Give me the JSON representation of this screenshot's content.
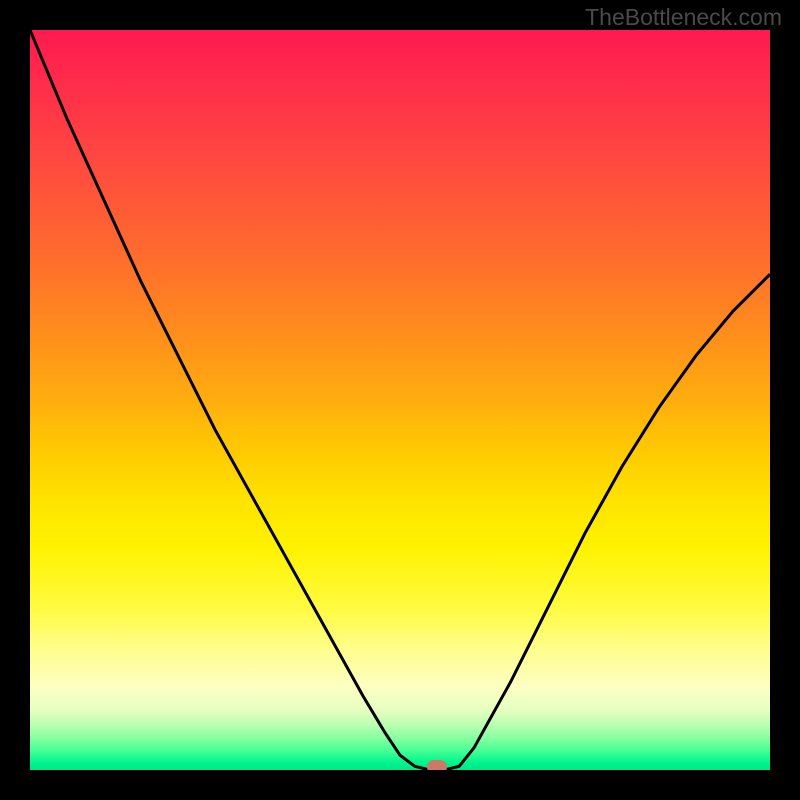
{
  "watermark": "TheBottleneck.com",
  "chart_data": {
    "type": "line",
    "title": "",
    "xlabel": "",
    "ylabel": "",
    "x_range": [
      0,
      100
    ],
    "y_range": [
      0,
      100
    ],
    "series": [
      {
        "name": "curve",
        "x": [
          0,
          5,
          10,
          15,
          20,
          25,
          30,
          35,
          40,
          45,
          48,
          50,
          52,
          54,
          56,
          58,
          60,
          65,
          70,
          75,
          80,
          85,
          90,
          95,
          100
        ],
        "y": [
          100,
          88,
          77,
          66,
          56,
          46,
          37,
          28,
          19,
          10,
          5,
          2,
          0.5,
          0,
          0,
          0.5,
          3,
          12,
          22,
          32,
          41,
          49,
          56,
          62,
          67
        ]
      }
    ],
    "marker": {
      "x": 55,
      "y": 0
    },
    "background": "rainbow-gradient-red-to-green"
  }
}
